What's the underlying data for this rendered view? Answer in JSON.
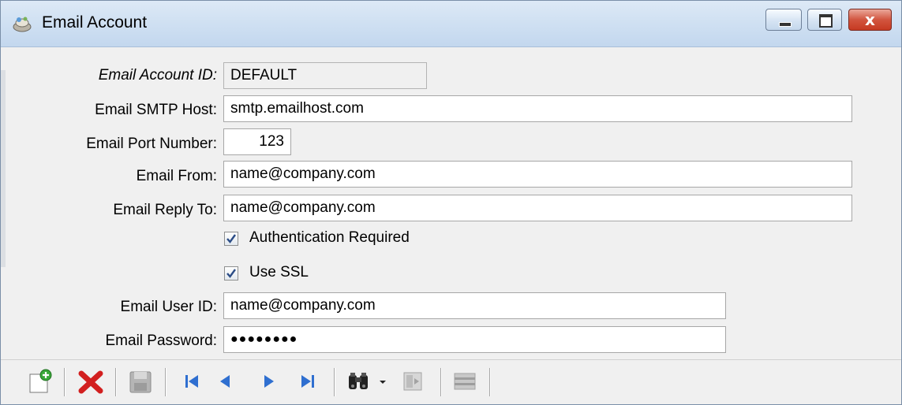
{
  "window": {
    "title": "Email Account",
    "icon": "app-icon",
    "controls": [
      "minimize-icon",
      "maximize-icon",
      "close-icon"
    ],
    "close_glyph": "x"
  },
  "form": {
    "account_id": {
      "label": "Email Account ID:",
      "value": "DEFAULT"
    },
    "smtp_host": {
      "label": "Email SMTP Host:",
      "value": "smtp.emailhost.com"
    },
    "port": {
      "label": "Email Port Number:",
      "value": "123"
    },
    "from": {
      "label": "Email From:",
      "value": "name@company.com"
    },
    "reply_to": {
      "label": "Email Reply To:",
      "value": "name@company.com"
    },
    "auth_required": {
      "label": "Authentication Required",
      "checked": true
    },
    "use_ssl": {
      "label": "Use SSL",
      "checked": true
    },
    "user_id": {
      "label": "Email User ID:",
      "value": "name@company.com"
    },
    "password": {
      "label": "Email Password:",
      "value": "●●●●●●●●"
    }
  },
  "toolbar": {
    "buttons": [
      "new-record-icon",
      "delete-icon",
      "save-icon",
      "first-record-icon",
      "previous-record-icon",
      "next-record-icon",
      "last-record-icon",
      "find-icon",
      "find-dropdown-icon",
      "filter-icon",
      "list-icon"
    ]
  },
  "colors": {
    "titlebar": "#cfe0f2",
    "close_button": "#c63a22",
    "nav_arrows": "#2f6fd0",
    "delete": "#d21f1f"
  }
}
